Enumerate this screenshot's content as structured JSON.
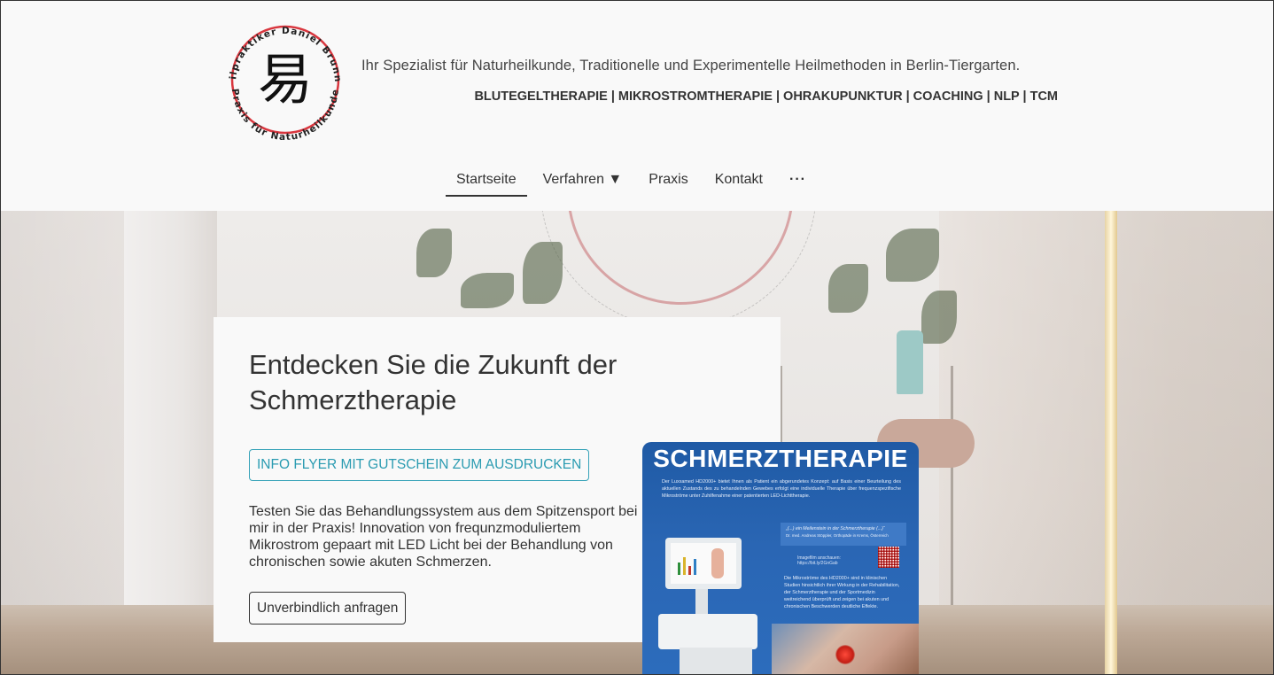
{
  "header": {
    "logo": {
      "ring_text_top": "Heilpraktiker Daniel Brunner",
      "ring_text_bottom": "Praxis für Naturheilkunde",
      "glyph": "易",
      "ring_color": "#d9363e"
    },
    "tagline": "Ihr Spezialist für Naturheilkunde, Traditionelle und Experimentelle Heilmethoden in Berlin-Tiergarten.",
    "services": "BLUTEGELTHERAPIE | MIKROSTROMTHERAPIE | OHRAKUPUNKTUR | COACHING | NLP | TCM"
  },
  "nav": {
    "items": [
      {
        "label": "Startseite",
        "active": true
      },
      {
        "label": "Verfahren ▼",
        "active": false
      },
      {
        "label": "Praxis",
        "active": false
      },
      {
        "label": "Kontakt",
        "active": false
      }
    ],
    "more": "···"
  },
  "hero": {
    "headline": "Entdecken Sie die Zukunft der Schmerztherapie",
    "flyer_button": "INFO FLYER MIT GUTSCHEIN ZUM AUSDRUCKEN",
    "description": "Testen Sie das Behandlungssystem aus dem Spitzensport bei mir in der Praxis! Innovation von frequnzmoduliertem Mikrostrom gepaart mit LED Licht bei der Behandlung von chronischen sowie akuten Schmerzen.",
    "request_button": "Unverbindlich anfragen",
    "accent_color": "#35a2b8"
  },
  "flyer": {
    "title": "SCHMERZTHERAPIE",
    "intro": "Der Luxxamed HD2000+ bietet Ihnen als Patient ein abgerundetes Konzept: auf Basis einer Beurteilung des aktuellen Zustands des zu behandelnden Gewebes erfolgt eine individuelle Therapie über frequenzspezifische Mikroströme unter Zuhilfenahme einer patentierten LED-Lichttherapie.",
    "quote": "„(...) ein Meilenstein in der Schmerztherapie (...)“",
    "quote_author": "Dr. med. Andreas Stöppler, Orthopäde in Krems, Österreich",
    "link_label": "Imagefilm anschauen:",
    "link": "https://bit.ly/2GnGab",
    "body": "Die Mikroströme des HD2000+ sind in klinischen Studien hinsichtlich ihrer Wirkung in der Rehabilitation, der Schmerztherapie und der Sportmedizin weitreichend überprüft und zeigen bei akuten und chronischen Beschwerden deutliche Effekte.",
    "background_color": "#2a66b4"
  }
}
